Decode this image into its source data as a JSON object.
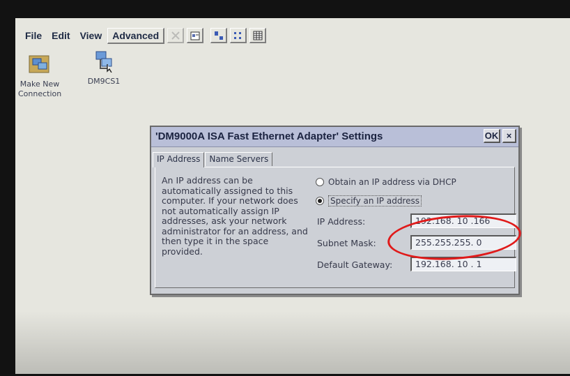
{
  "menubar": {
    "items": [
      "File",
      "Edit",
      "View",
      "Advanced"
    ],
    "toolbar_icons": [
      "delete-icon",
      "properties-icon",
      "large-icons-icon",
      "small-icons-icon",
      "details-icon"
    ]
  },
  "desktop_icons": [
    {
      "label_line1": "Make New",
      "label_line2": "Connection",
      "icon": "network-folder-icon"
    },
    {
      "label_line1": "DM9CS1",
      "label_line2": "",
      "icon": "network-adapter-icon"
    }
  ],
  "dialog": {
    "title": "'DM9000A ISA Fast Ethernet Adapter' Settings",
    "ok_label": "OK",
    "close_label": "×",
    "tabs": [
      {
        "label": "IP Address",
        "active": true
      },
      {
        "label": "Name Servers",
        "active": false
      }
    ],
    "description": "An IP address can be automatically assigned to this computer.  If your network does not automatically assign IP addresses, ask your network administrator for an address, and then type it in the space provided.",
    "radio_dhcp": {
      "label": "Obtain an IP address via DHCP",
      "checked": false
    },
    "radio_specify": {
      "label": "Specify an IP address",
      "checked": true
    },
    "fields": {
      "ip": {
        "label": "IP Address:",
        "value": "192.168. 10 .166"
      },
      "subnet": {
        "label": "Subnet Mask:",
        "value": "255.255.255.  0"
      },
      "gateway": {
        "label": "Default Gateway:",
        "value": "192.168. 10 .  1"
      }
    }
  },
  "colors": {
    "annotation": "#e01a1a",
    "titlebar": "#b9bfd8",
    "dialog_bg": "#cdd0d6",
    "desktop_bg": "#e6e6df"
  }
}
